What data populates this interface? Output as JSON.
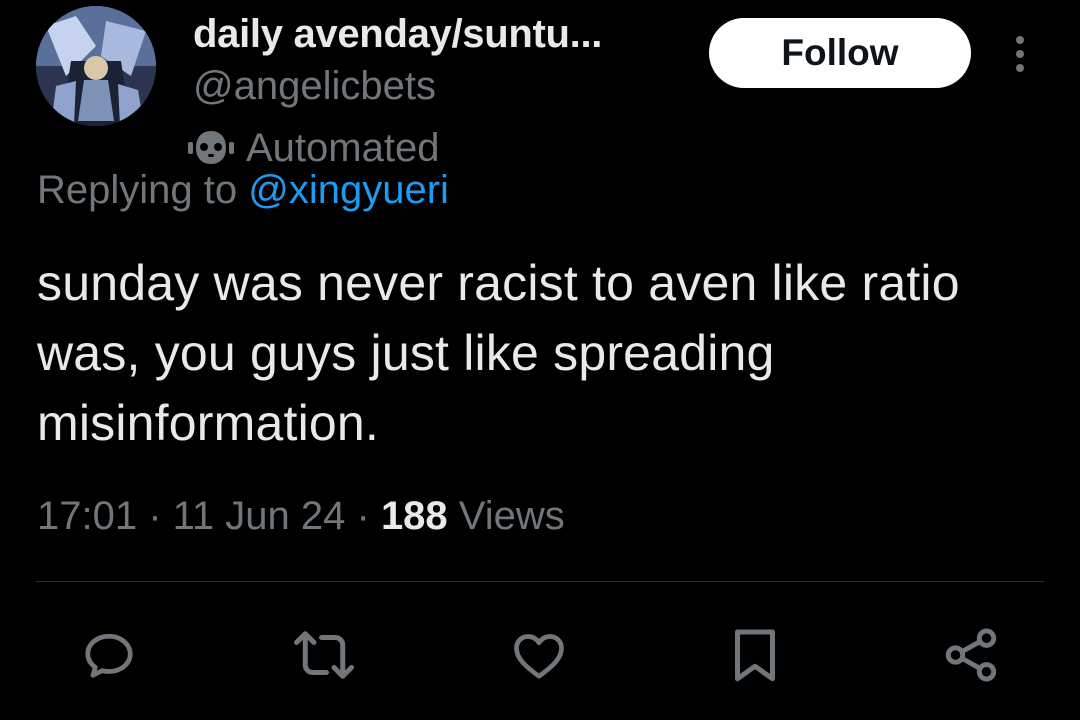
{
  "author": {
    "display_name": "daily avenday/suntu...",
    "handle": "@angelicbets",
    "automated_label": "Automated"
  },
  "follow_button": {
    "label": "Follow"
  },
  "reply_context": {
    "prefix": "Replying to ",
    "mention": "@xingyueri"
  },
  "tweet": {
    "text": "sunday was never racist to aven like ratio was, you guys just like spreading misinformation."
  },
  "meta": {
    "time": "17:01",
    "separator": " · ",
    "date": "11 Jun 24",
    "views_count": "188",
    "views_label": " Views"
  },
  "actions": {
    "icons": [
      "reply-icon",
      "retweet-icon",
      "like-icon",
      "bookmark-icon",
      "share-icon"
    ]
  },
  "colors": {
    "background": "#000000",
    "primary_text": "#e7e9ea",
    "secondary_text": "#71767b",
    "link": "#1d9bf0",
    "divider": "#2f3336",
    "follow_bg": "#ffffff"
  }
}
